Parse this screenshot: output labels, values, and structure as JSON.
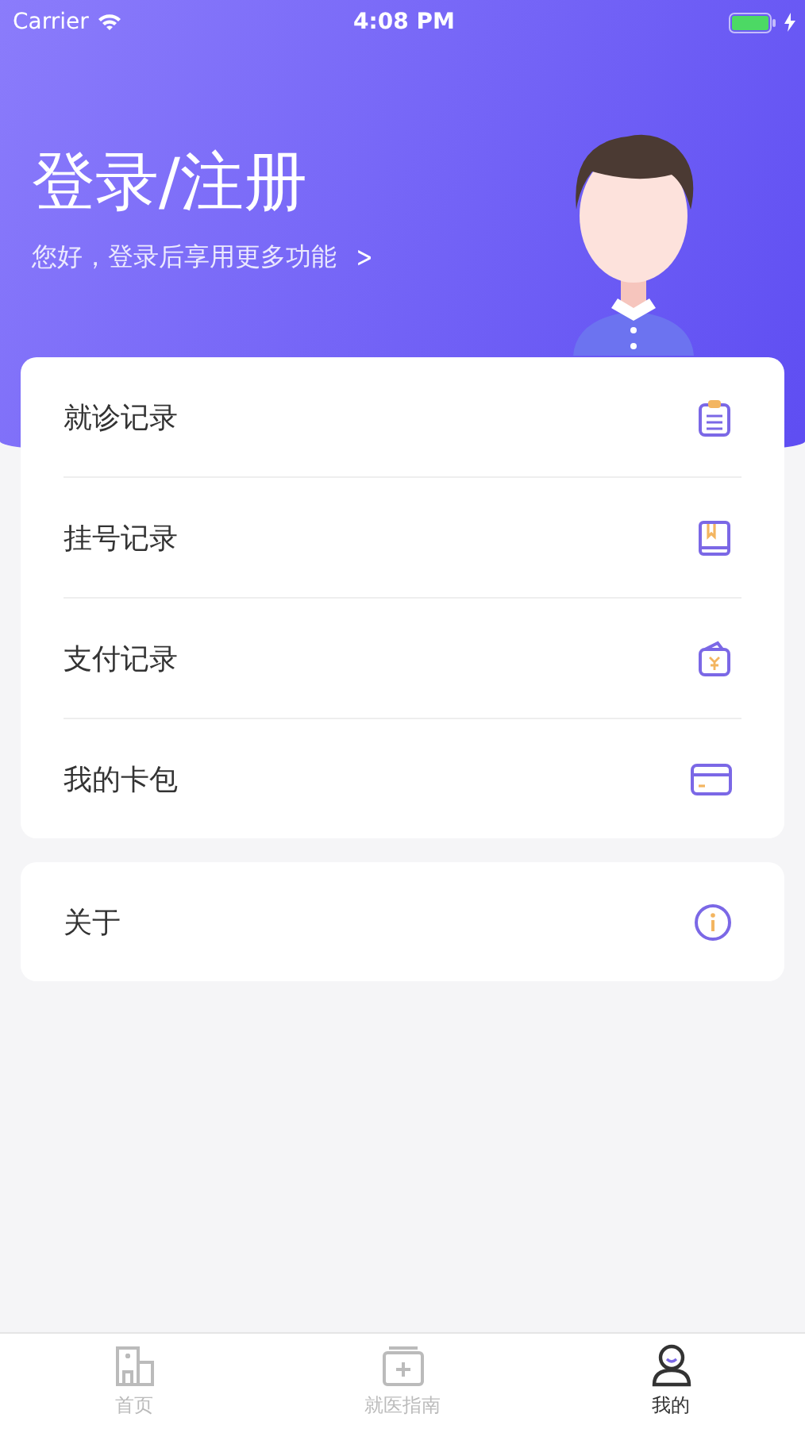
{
  "status_bar": {
    "carrier": "Carrier",
    "time": "4:08 PM",
    "charging": true
  },
  "header": {
    "title": "登录/注册",
    "subtitle": "您好，登录后享用更多功能",
    "chevron": ">"
  },
  "menu_groups": [
    {
      "items": [
        {
          "label": "就诊记录",
          "kind": "clipboard"
        },
        {
          "label": "挂号记录",
          "kind": "book"
        },
        {
          "label": "支付记录",
          "kind": "wallet"
        },
        {
          "label": "我的卡包",
          "kind": "card"
        }
      ]
    },
    {
      "items": [
        {
          "label": "关于",
          "kind": "info"
        }
      ]
    }
  ],
  "tab_bar": [
    {
      "label": "首页",
      "kind": "home",
      "selected": false
    },
    {
      "label": "就医指南",
      "kind": "guide",
      "selected": false
    },
    {
      "label": "我的",
      "kind": "profile",
      "selected": true
    }
  ]
}
